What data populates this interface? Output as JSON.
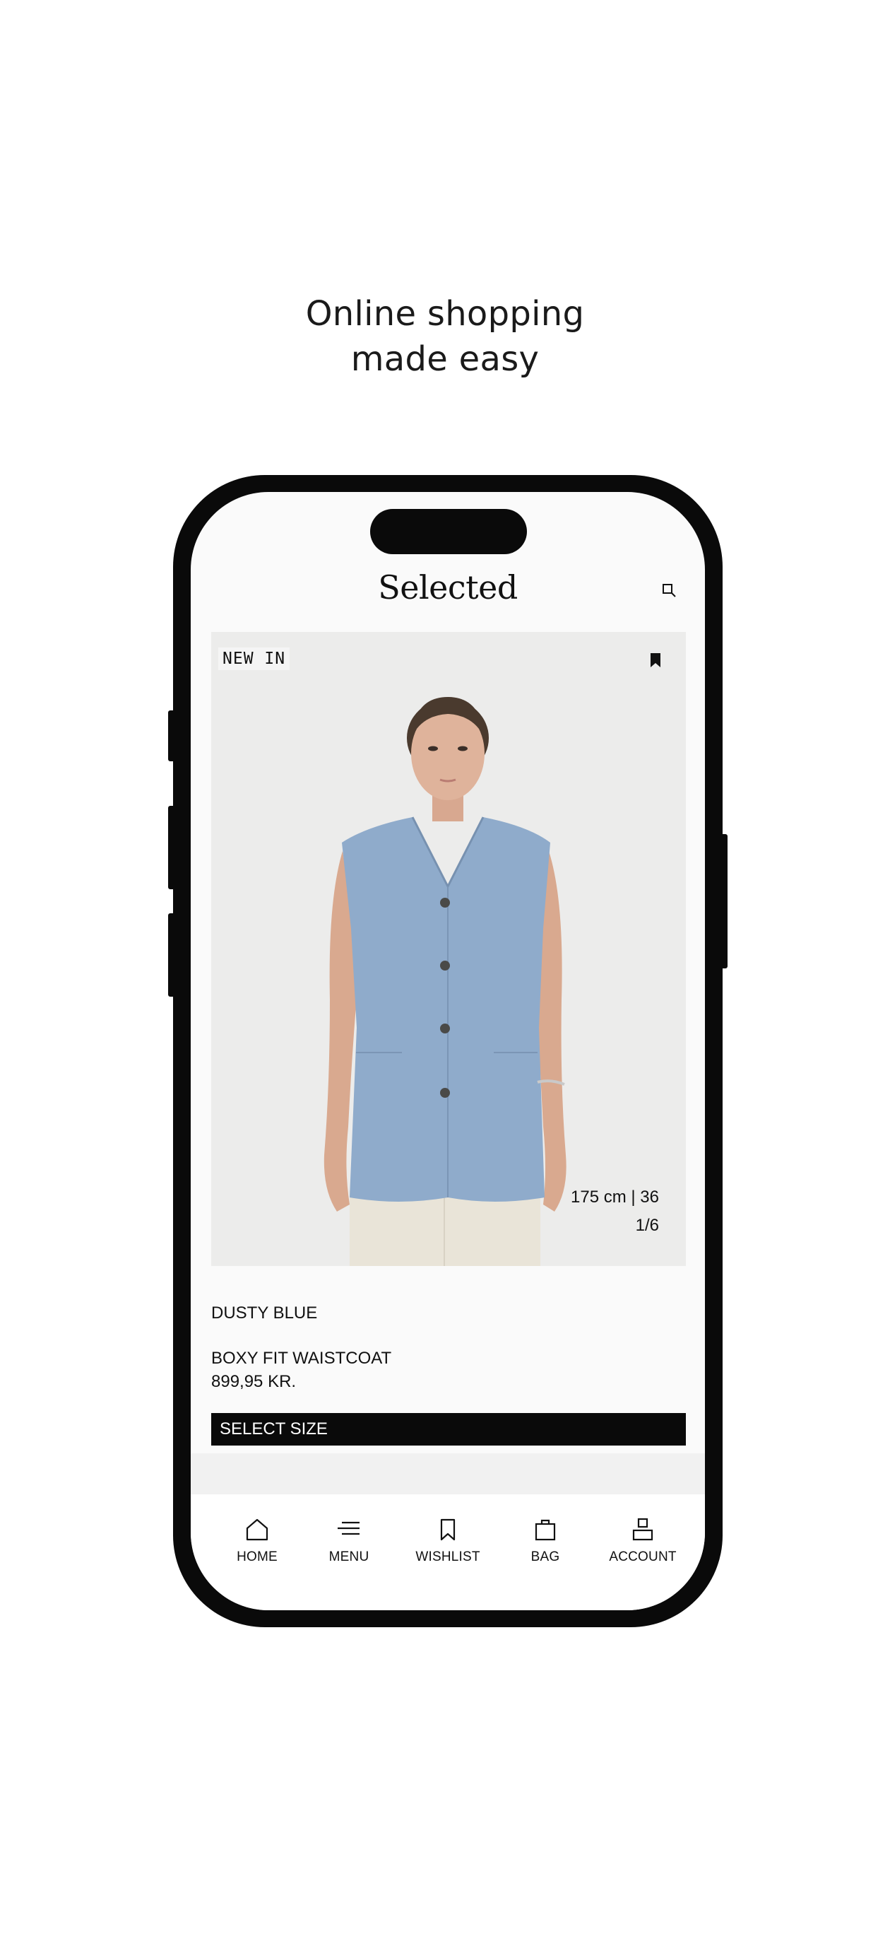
{
  "headline": {
    "line1": "Online shopping",
    "line2": "made easy"
  },
  "app": {
    "brand": "Selected",
    "search_icon": "search-icon",
    "product": {
      "badge": "NEW IN",
      "bookmark_icon": "bookmark-filled-icon",
      "model_size": "175 cm | 36",
      "image_index": "1/6",
      "color_name": "DUSTY BLUE",
      "name": "BOXY FIT WAISTCOAT",
      "price": "899,95 KR.",
      "cta": "SELECT SIZE"
    },
    "tabs": [
      {
        "label": "HOME",
        "icon": "home-icon"
      },
      {
        "label": "MENU",
        "icon": "menu-icon"
      },
      {
        "label": "WISHLIST",
        "icon": "bookmark-icon"
      },
      {
        "label": "BAG",
        "icon": "bag-icon"
      },
      {
        "label": "ACCOUNT",
        "icon": "account-icon"
      }
    ]
  },
  "colors": {
    "background": "#ffffff",
    "phone_frame": "#0a0a0a",
    "screen": "#fafafa",
    "image_bg": "#ececeb",
    "garment": "#8fabcb",
    "cta_bg": "#0a0a0a",
    "cta_text": "#ffffff"
  }
}
